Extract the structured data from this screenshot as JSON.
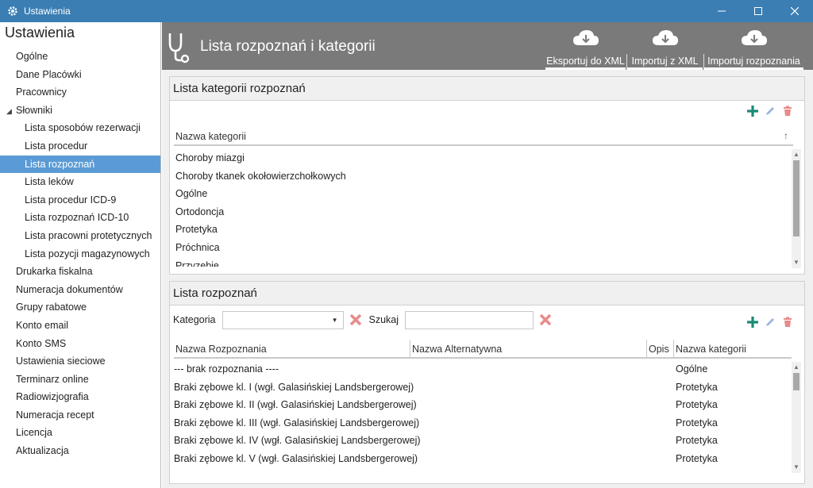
{
  "window": {
    "title": "Ustawienia",
    "minimize": "—",
    "maximize": "☐",
    "close": "✕"
  },
  "sidebar": {
    "title": "Ustawienia",
    "items": [
      {
        "label": "Ogólne"
      },
      {
        "label": "Dane Placówki"
      },
      {
        "label": "Pracownicy"
      },
      {
        "label": "Słowniki"
      },
      {
        "label": "Lista sposobów rezerwacji"
      },
      {
        "label": "Lista procedur"
      },
      {
        "label": "Lista rozpoznań"
      },
      {
        "label": "Lista leków"
      },
      {
        "label": "Lista procedur ICD-9"
      },
      {
        "label": "Lista rozpoznań ICD-10"
      },
      {
        "label": "Lista pracowni protetycznych"
      },
      {
        "label": "Lista pozycji magazynowych"
      },
      {
        "label": "Drukarka fiskalna"
      },
      {
        "label": "Numeracja dokumentów"
      },
      {
        "label": "Grupy rabatowe"
      },
      {
        "label": "Konto email"
      },
      {
        "label": "Konto SMS"
      },
      {
        "label": "Ustawienia sieciowe"
      },
      {
        "label": "Terminarz online"
      },
      {
        "label": "Radiowizjografia"
      },
      {
        "label": "Numeracja recept"
      },
      {
        "label": "Licencja"
      },
      {
        "label": "Aktualizacja"
      }
    ]
  },
  "header": {
    "title": "Lista rozpoznań i kategorii",
    "buttons": {
      "export": "Eksportuj do XML",
      "import": "Importuj z XML",
      "import_diag": "Importuj rozpoznania"
    }
  },
  "categories": {
    "title": "Lista kategorii rozpoznań",
    "column": "Nazwa kategorii",
    "sort_glyph": "↑",
    "rows": [
      "Choroby miazgi",
      "Choroby tkanek okołowierzchołkowych",
      "Ogólne",
      "Ortodoncja",
      "Protetyka",
      "Próchnica",
      "Przyzebie"
    ]
  },
  "diagnoses": {
    "title": "Lista rozpoznań",
    "category_label": "Kategoria",
    "search_label": "Szukaj",
    "columns": {
      "name": "Nazwa Rozpoznania",
      "alt": "Nazwa Alternatywna",
      "desc": "Opis",
      "category": "Nazwa kategorii"
    },
    "rows": [
      {
        "name": "--- brak rozpoznania ----",
        "category": "Ogólne"
      },
      {
        "name": "Braki zębowe kl. I (wgł. Galasińskiej Landsbergerowej)",
        "category": "Protetyka"
      },
      {
        "name": "Braki zębowe kl. II (wgł. Galasińskiej Landsbergerowej)",
        "category": "Protetyka"
      },
      {
        "name": "Braki zębowe kl. III (wgł. Galasińskiej Landsbergerowej)",
        "category": "Protetyka"
      },
      {
        "name": "Braki zębowe kl. IV (wgł. Galasińskiej Landsbergerowej)",
        "category": "Protetyka"
      },
      {
        "name": "Braki zębowe kl. V (wgł. Galasińskiej Landsbergerowej)",
        "category": "Protetyka"
      }
    ]
  },
  "colors": {
    "titlebar": "#3b7eb3",
    "header": "#7a7a7a",
    "active": "#5b9bd5",
    "add": "#1a8a74",
    "edit": "#9db6e0",
    "delete": "#e88a8a"
  }
}
